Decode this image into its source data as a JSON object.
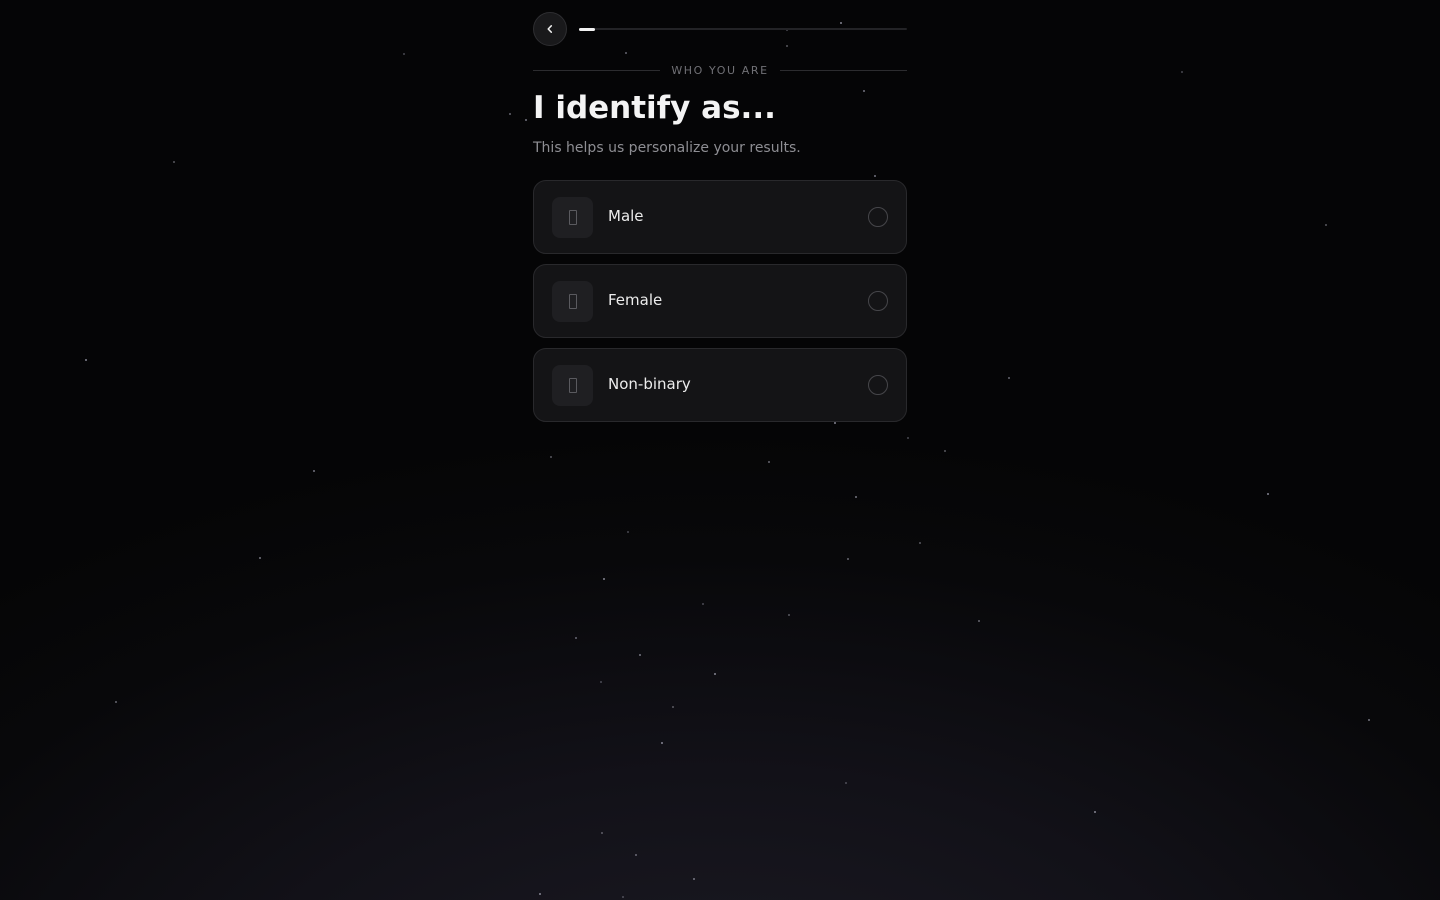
{
  "header": {
    "back_button_icon": "chevron-left-icon",
    "progress": {
      "current_step_fraction": 0.05
    }
  },
  "section": {
    "eyebrow": "WHO YOU ARE",
    "title": "I identify as...",
    "subtitle": "This helps us personalize your results."
  },
  "options": [
    {
      "label": "Male",
      "icon": "emoji-placeholder-icon",
      "selected": false
    },
    {
      "label": "Female",
      "icon": "emoji-placeholder-icon",
      "selected": false
    },
    {
      "label": "Non-binary",
      "icon": "emoji-placeholder-icon",
      "selected": false
    }
  ],
  "theme": {
    "background": "#060607",
    "card_background": "#141416",
    "card_border": "#29292c",
    "text_primary": "#f4f4f4",
    "text_muted": "#8e8e93",
    "accent": "#f2f2f2"
  }
}
